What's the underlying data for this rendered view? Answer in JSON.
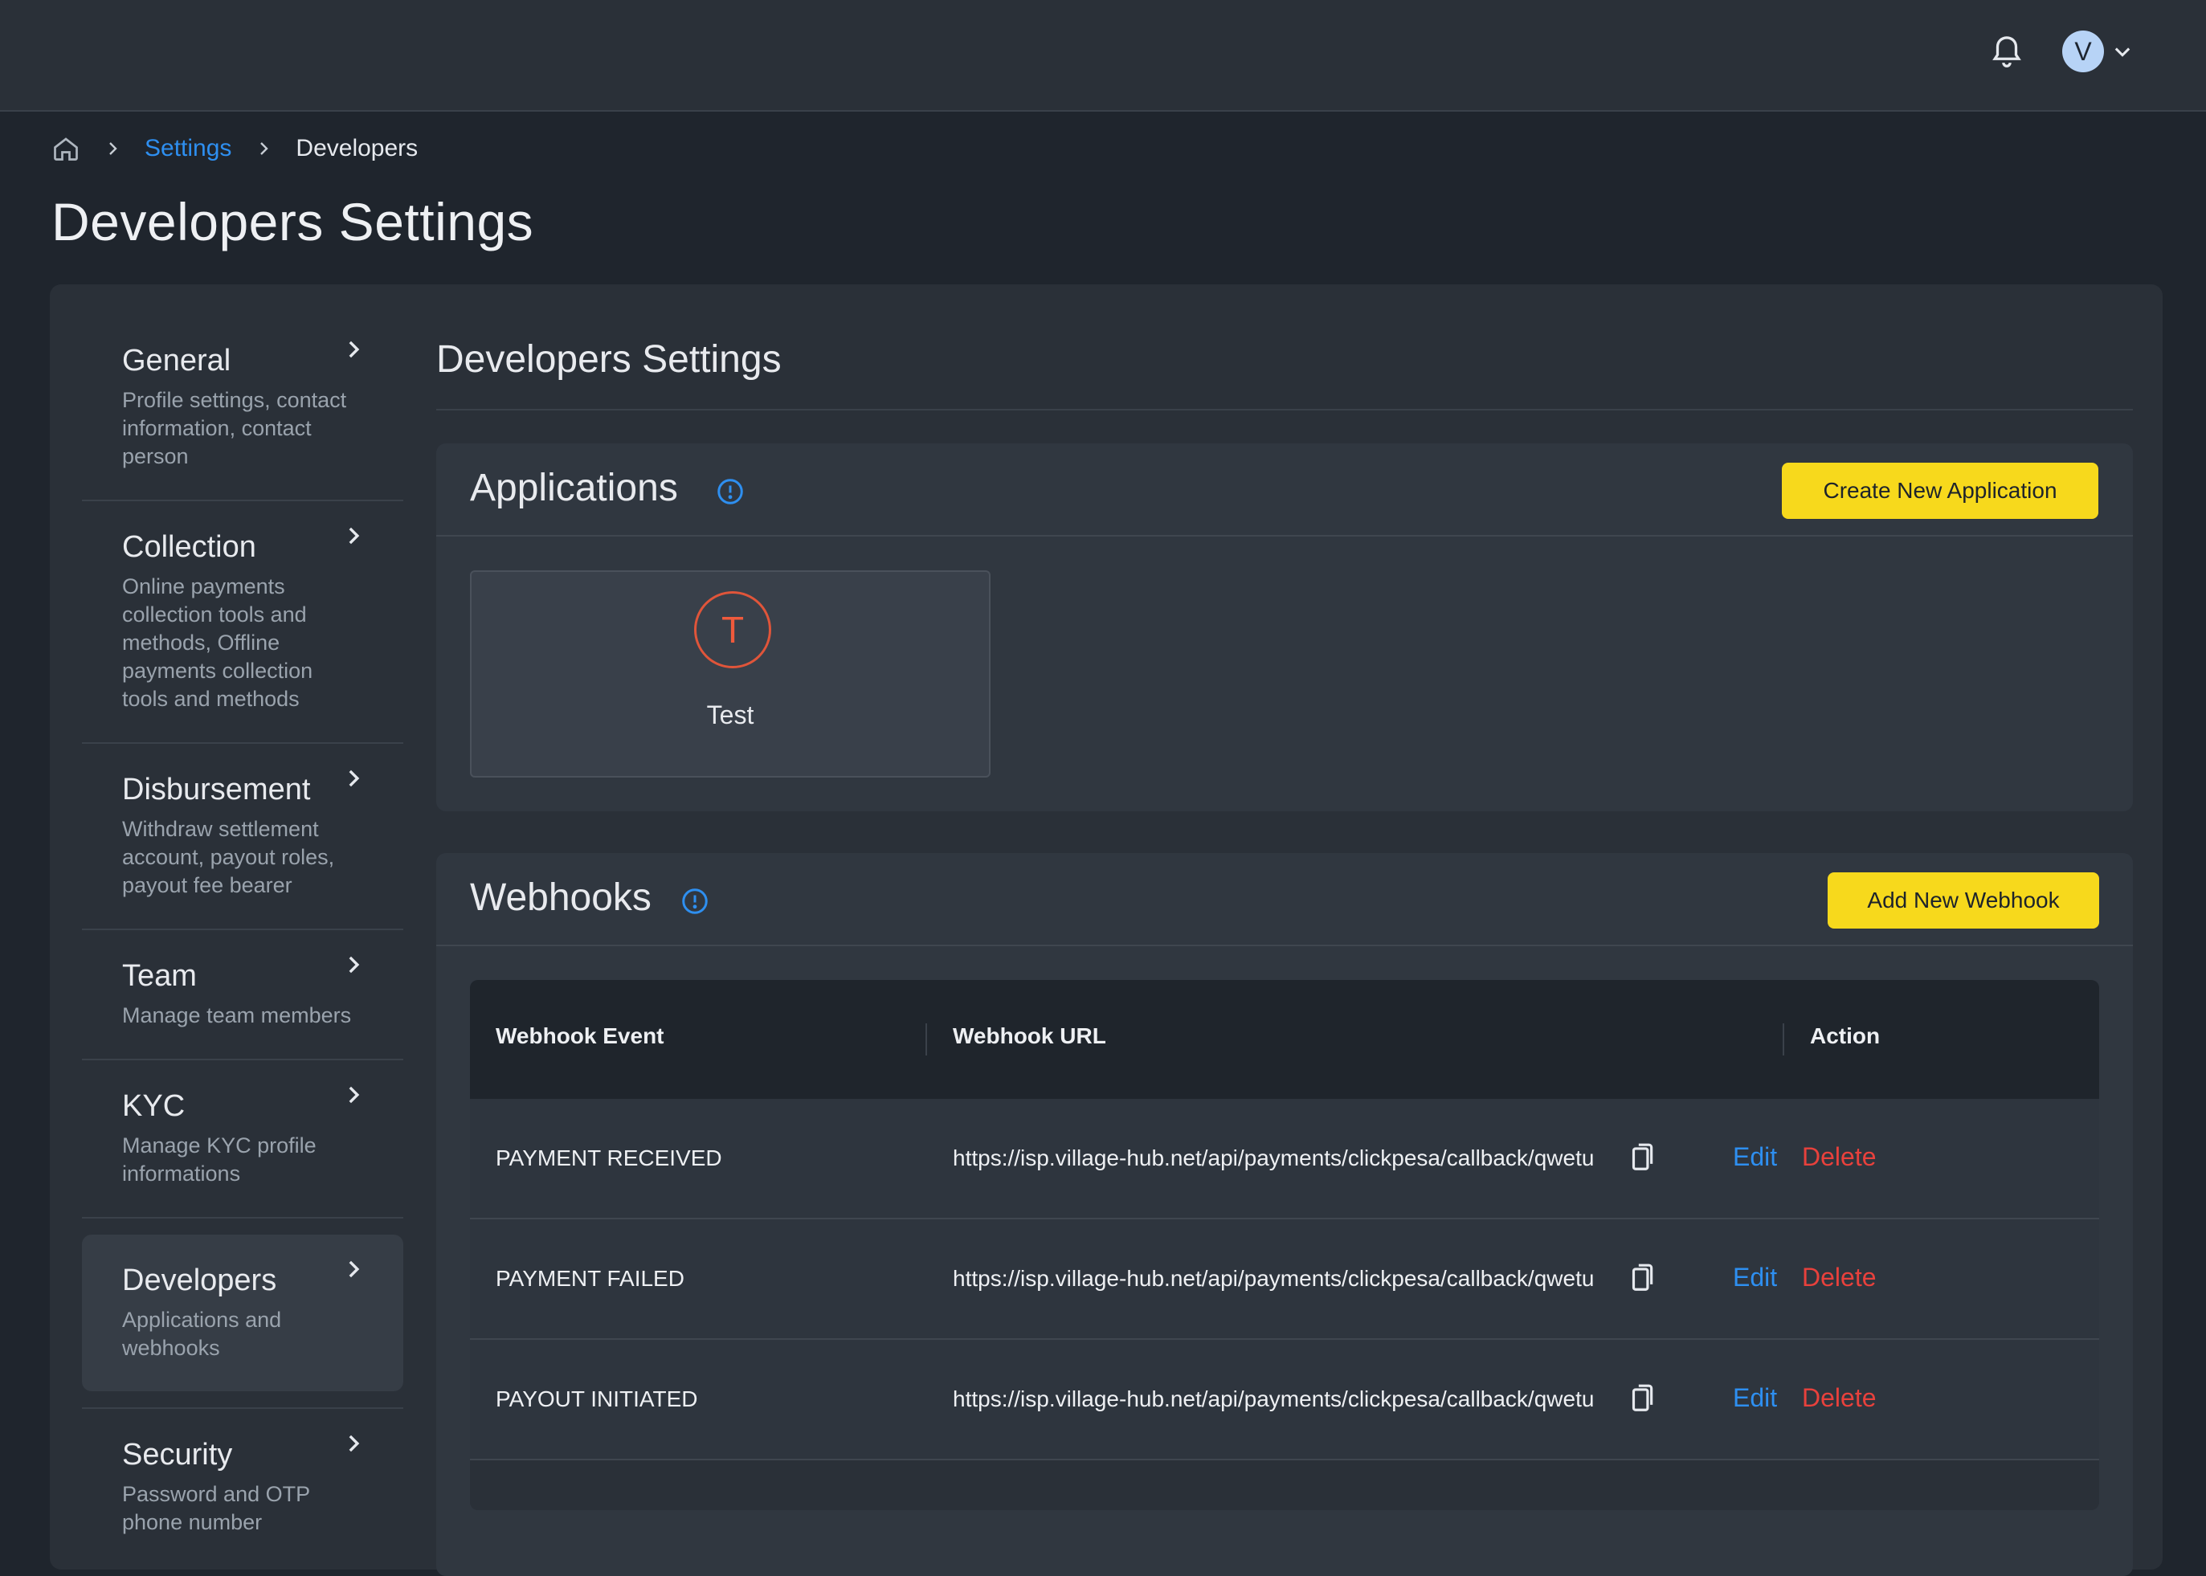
{
  "topbar": {
    "avatar_initial": "V"
  },
  "breadcrumb": {
    "settings": "Settings",
    "current": "Developers"
  },
  "page_title": "Developers Settings",
  "sidebar": {
    "items": [
      {
        "title": "General",
        "desc": "Profile settings, contact information, contact person"
      },
      {
        "title": "Collection",
        "desc": "Online payments collection tools and methods, Offline payments collection tools and methods"
      },
      {
        "title": "Disbursement",
        "desc": "Withdraw settlement account, payout roles, payout fee bearer"
      },
      {
        "title": "Team",
        "desc": "Manage team members"
      },
      {
        "title": "KYC",
        "desc": "Manage KYC profile informations"
      },
      {
        "title": "Developers",
        "desc": "Applications and webhooks"
      },
      {
        "title": "Security",
        "desc": "Password and OTP phone number"
      }
    ]
  },
  "content": {
    "title": "Developers Settings"
  },
  "applications": {
    "title": "Applications",
    "create_label": "Create New Application",
    "apps": [
      {
        "initial": "T",
        "name": "Test"
      }
    ]
  },
  "webhooks": {
    "title": "Webhooks",
    "add_label": "Add New Webhook",
    "columns": {
      "event": "Webhook Event",
      "url": "Webhook URL",
      "action": "Action"
    },
    "rows": [
      {
        "event": "PAYMENT RECEIVED",
        "url": "https://isp.village-hub.net/api/payments/clickpesa/callback/qwetu",
        "edit": "Edit",
        "delete": "Delete"
      },
      {
        "event": "PAYMENT FAILED",
        "url": "https://isp.village-hub.net/api/payments/clickpesa/callback/qwetu",
        "edit": "Edit",
        "delete": "Delete"
      },
      {
        "event": "PAYOUT INITIATED",
        "url": "https://isp.village-hub.net/api/payments/clickpesa/callback/qwetu",
        "edit": "Edit",
        "delete": "Delete"
      }
    ]
  }
}
